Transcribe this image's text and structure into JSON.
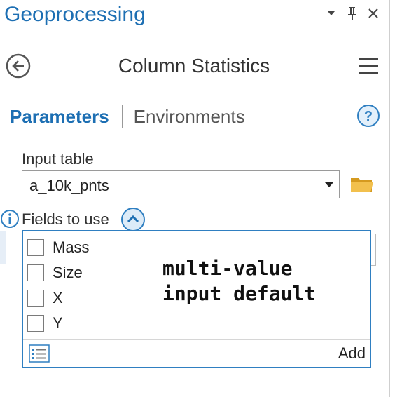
{
  "pane": {
    "title": "Geoprocessing",
    "controls": [
      "chevron-down-icon",
      "pin-icon",
      "close-icon"
    ]
  },
  "tool": {
    "title": "Column Statistics"
  },
  "tabs": {
    "parameters": "Parameters",
    "environments": "Environments"
  },
  "input_table": {
    "label": "Input table",
    "value": "a_10k_pnts"
  },
  "fields_to_use": {
    "label": "Fields to use",
    "items": [
      {
        "label": "Mass",
        "checked": false
      },
      {
        "label": "Size",
        "checked": false
      },
      {
        "label": "X",
        "checked": false
      },
      {
        "label": "Y",
        "checked": false
      }
    ],
    "add_label": "Add"
  },
  "annotation": {
    "line1": "multi-value",
    "line2": "input default"
  },
  "colors": {
    "accent": "#1d6fb3",
    "focus_border": "#2f7fc1",
    "folder": "#e8b23a"
  }
}
